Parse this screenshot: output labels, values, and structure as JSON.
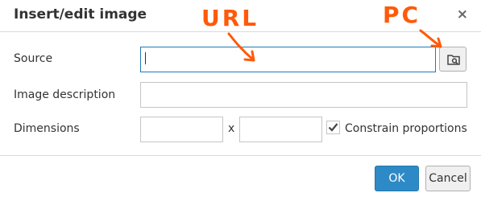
{
  "dialog": {
    "title": "Insert/edit image",
    "close_glyph": "×"
  },
  "form": {
    "source_label": "Source",
    "source_value": "",
    "description_label": "Image description",
    "description_value": "",
    "dimensions_label": "Dimensions",
    "width_value": "",
    "height_value": "",
    "dimension_separator": "x",
    "constrain_label": "Constrain proportions",
    "constrain_checked": true
  },
  "buttons": {
    "ok": "OK",
    "cancel": "Cancel"
  },
  "annotations": {
    "url": "URL",
    "pc": "PC",
    "color": "#ff5a0a"
  },
  "colors": {
    "primary": "#2d8ac7",
    "focus_border": "#207ab7"
  }
}
